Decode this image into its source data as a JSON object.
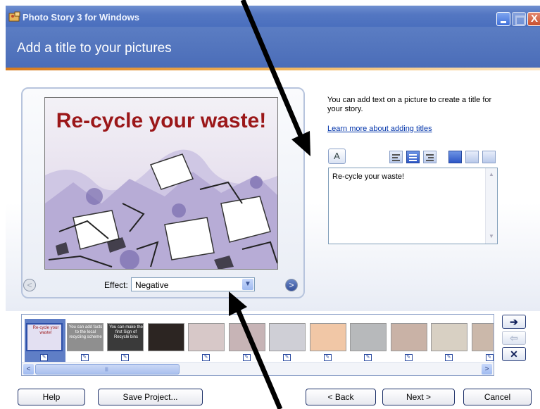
{
  "window": {
    "title": "Photo Story 3 for Windows",
    "close_glyph": "X"
  },
  "header": {
    "title": "Add a title to your pictures"
  },
  "preview": {
    "overlay_title": "Re-cycle your waste!",
    "effect_label": "Effect:",
    "effect_value": "Negative"
  },
  "right_panel": {
    "help_text": "You can add text on a picture to create a title for your story.",
    "learn_link": "Learn more about adding titles",
    "title_text": "Re-cycle your waste!",
    "toolbar_icons": [
      "font-icon",
      "align-left-icon",
      "align-center-icon",
      "align-right-icon",
      "align-top-icon",
      "align-middle-icon",
      "align-bottom-icon"
    ]
  },
  "filmstrip": {
    "thumbs": [
      {
        "caption": "Re-cycle your waste!"
      },
      {
        "caption": "You can add facts to the local recycling scheme"
      },
      {
        "caption": "You can make the first Sign of Recycle bins"
      },
      {
        "caption": ""
      },
      {
        "caption": ""
      },
      {
        "caption": ""
      },
      {
        "caption": ""
      },
      {
        "caption": ""
      },
      {
        "caption": ""
      },
      {
        "caption": ""
      },
      {
        "caption": ""
      },
      {
        "caption": ""
      }
    ]
  },
  "buttons": {
    "help": "Help",
    "save_project": "Save Project...",
    "back": "< Back",
    "next": "Next >",
    "cancel": "Cancel"
  },
  "colors": {
    "header": "#4b6db8",
    "accent_line": "#d77b1f",
    "overlay_text": "#9b1719"
  }
}
